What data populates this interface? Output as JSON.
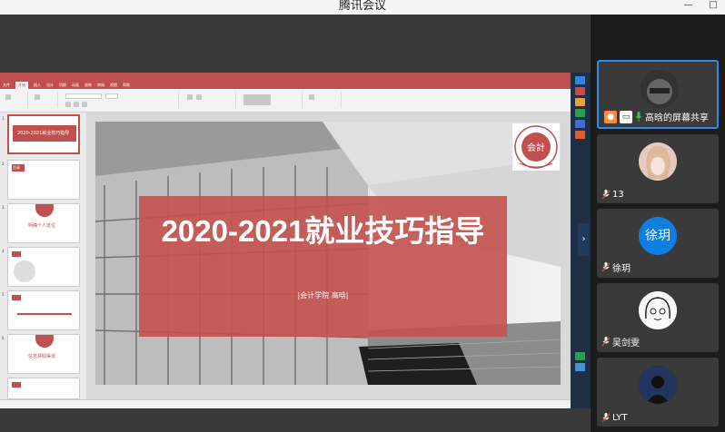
{
  "window": {
    "title": "腾讯会议",
    "minimize": "—",
    "maximize": "□"
  },
  "ppt": {
    "tabs": [
      "文件",
      "开始",
      "插入",
      "设计",
      "切换",
      "动画",
      "放映",
      "审阅",
      "视图",
      "帮助"
    ],
    "active_tab": "开始",
    "thumbnails": [
      {
        "num": "1",
        "title": "2020-2021就业技巧指导"
      },
      {
        "num": "2",
        "title": "目录"
      },
      {
        "num": "3",
        "title": "明确个人定位"
      },
      {
        "num": "4",
        "title": ""
      },
      {
        "num": "5",
        "title": ""
      },
      {
        "num": "6",
        "title": "信息获取渠道"
      }
    ],
    "slide": {
      "title": "2020-2021就业技巧指导",
      "subtitle": "|会计学院   高晗|",
      "logo_text": "会計"
    }
  },
  "participants": [
    {
      "name": "高晗的屏幕共享",
      "avatar_text": "",
      "role": "presenter"
    },
    {
      "name": "13",
      "avatar_text": "",
      "role": "member"
    },
    {
      "name": "徐玥",
      "avatar_text": "徐玥",
      "role": "member"
    },
    {
      "name": "吴剑雯",
      "avatar_text": "",
      "role": "member"
    },
    {
      "name": "LYT",
      "avatar_text": "",
      "role": "member"
    }
  ],
  "colors": {
    "ppt_accent": "#c0504d",
    "slide_band": "#c4524e",
    "avatar_blue": "#0e7fe1",
    "panel_bg": "#1c1c1c",
    "tile_bg": "#3a3a3a",
    "mic_muted": "#e05050",
    "mic_on": "#3fbf4f"
  },
  "icons": {
    "presenter": "person-icon",
    "screen_share": "screen-share-icon",
    "mic_on": "microphone-icon",
    "mic_muted": "microphone-muted-icon",
    "collapse": "chevron-right-icon"
  }
}
